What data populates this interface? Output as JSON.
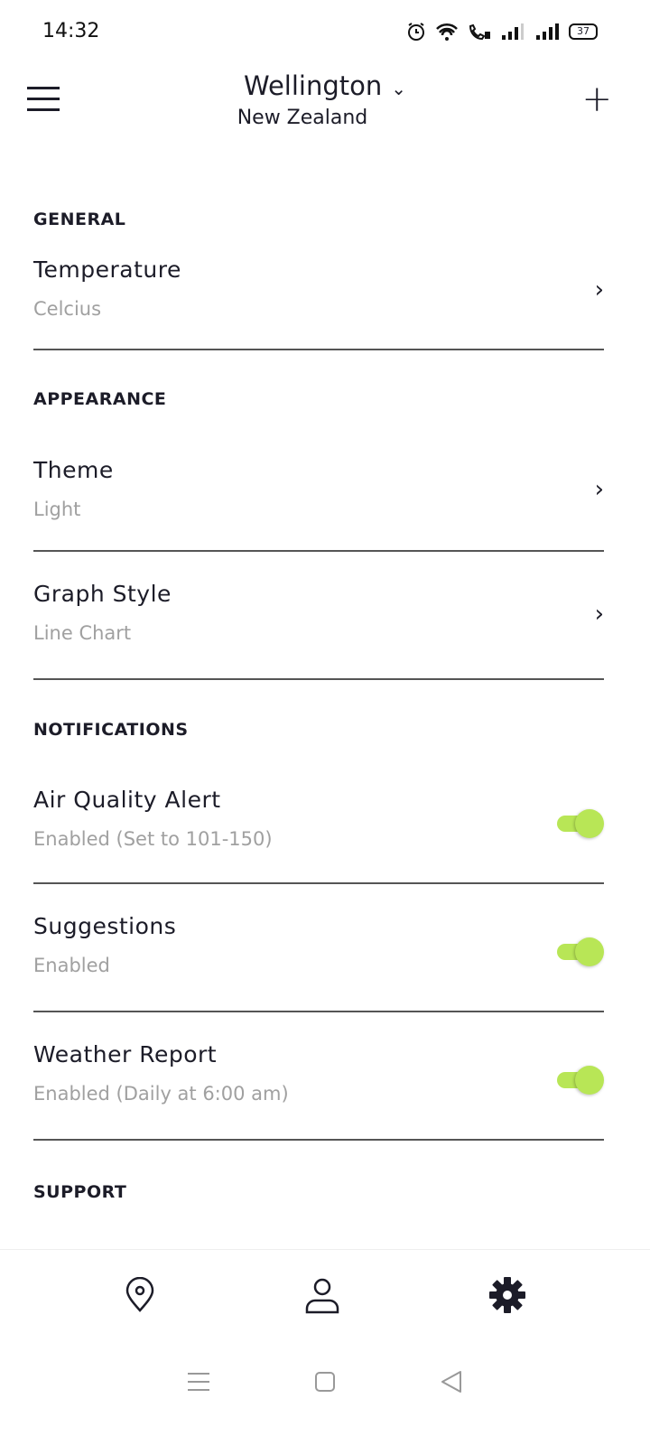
{
  "status_bar": {
    "time": "14:32",
    "battery": "37",
    "icons": [
      "alarm-icon",
      "wifi-icon",
      "wifi-call-icon",
      "signal-icon",
      "signal-icon",
      "battery-icon"
    ]
  },
  "header": {
    "city": "Wellington",
    "country": "New Zealand"
  },
  "sections": {
    "general": {
      "title": "GENERAL",
      "items": [
        {
          "title": "Temperature",
          "value": "Celcius"
        }
      ]
    },
    "appearance": {
      "title": "APPEARANCE",
      "items": [
        {
          "title": "Theme",
          "value": "Light"
        },
        {
          "title": "Graph Style",
          "value": "Line Chart"
        }
      ]
    },
    "notifications": {
      "title": "NOTIFICATIONS",
      "items": [
        {
          "title": "Air Quality Alert",
          "value": "Enabled (Set to 101-150)",
          "on": true
        },
        {
          "title": "Suggestions",
          "value": "Enabled",
          "on": true
        },
        {
          "title": "Weather Report",
          "value": "Enabled (Daily at 6:00 am)",
          "on": true
        }
      ]
    },
    "support": {
      "title": "SUPPORT"
    }
  },
  "colors": {
    "toggle": "#b8e656",
    "text": "#1c1c28"
  },
  "bottom_nav": [
    "location-icon",
    "profile-icon",
    "settings-icon"
  ]
}
